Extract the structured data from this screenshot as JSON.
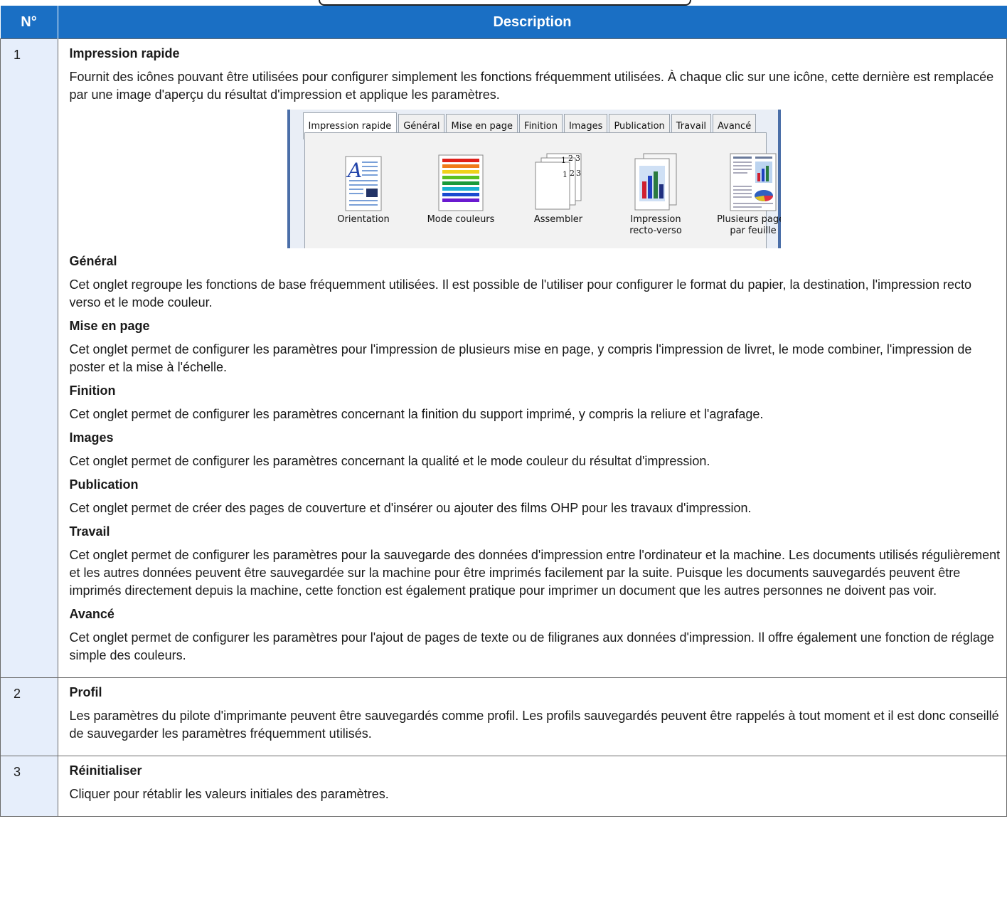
{
  "table": {
    "headers": {
      "num": "N°",
      "desc": "Description"
    },
    "rows": [
      {
        "num": "1",
        "title": "Impression rapide",
        "text": "Fournit des icônes pouvant être utilisées pour configurer simplement les fonctions fréquemment utilisées. À chaque clic sur une icône, cette dernière est remplacée par une image d'aperçu du résultat d'impression et applique les paramètres.",
        "sections": [
          {
            "title": "Général",
            "text": "Cet onglet regroupe les fonctions de base fréquemment utilisées. Il est possible de l'utiliser pour configurer le format du papier, la destination, l'impression recto verso et le mode couleur."
          },
          {
            "title": "Mise en page",
            "text": "Cet onglet permet de configurer les paramètres pour l'impression de plusieurs mise en page, y compris l'impression de livret, le mode combiner, l'impression de poster et la mise à l'échelle."
          },
          {
            "title": "Finition",
            "text": "Cet onglet permet de configurer les paramètres concernant la finition du support imprimé, y compris la reliure et l'agrafage."
          },
          {
            "title": "Images",
            "text": "Cet onglet permet de configurer les paramètres concernant la qualité et le mode couleur du résultat d'impression."
          },
          {
            "title": "Publication",
            "text": "Cet onglet permet de créer des pages de couverture et d'insérer ou ajouter des films OHP pour les travaux d'impression."
          },
          {
            "title": "Travail",
            "text": "Cet onglet permet de configurer les paramètres pour la sauvegarde des données d'impression entre l'ordinateur et la machine. Les documents utilisés régulièrement et les autres données peuvent être sauvegardée sur la machine pour être imprimés facilement par la suite. Puisque les documents sauvegardés peuvent être imprimés directement depuis la machine, cette fonction est également pratique pour imprimer un document que les autres personnes ne doivent pas voir."
          },
          {
            "title": "Avancé",
            "text": "Cet onglet permet de configurer les paramètres pour l'ajout de pages de texte ou de filigranes aux données d'impression. Il offre également une fonction de réglage simple des couleurs."
          }
        ]
      },
      {
        "num": "2",
        "title": "Profil",
        "text": "Les paramètres du pilote d'imprimante peuvent être sauvegardés comme profil. Les profils sauvegardés peuvent être rappelés à tout moment et il est donc conseillé de sauvegarder les paramètres fréquemment utilisés."
      },
      {
        "num": "3",
        "title": "Réinitialiser",
        "text": "Cliquer pour rétablir les valeurs initiales des paramètres."
      }
    ]
  },
  "screenshot": {
    "tabs": [
      "Impression rapide",
      "Général",
      "Mise en page",
      "Finition",
      "Images",
      "Publication",
      "Travail",
      "Avancé"
    ],
    "active_tab": 0,
    "icons": [
      {
        "icon": "orientation-icon",
        "label_1": "Orientation",
        "label_2": ""
      },
      {
        "icon": "color-mode-icon",
        "label_1": "Mode couleurs",
        "label_2": ""
      },
      {
        "icon": "collate-icon",
        "label_1": "Assembler",
        "label_2": ""
      },
      {
        "icon": "duplex-icon",
        "label_1": "Impression",
        "label_2": "recto-verso"
      },
      {
        "icon": "multi-page-icon",
        "label_1": "Plusieurs pages",
        "label_2": "par feuille"
      }
    ],
    "collate_digits": [
      "1",
      "2",
      "3"
    ],
    "colors": {
      "header_bg": "#1a6fc4",
      "num_bg": "#e6eefb",
      "frame": "#4a6ea8"
    }
  }
}
